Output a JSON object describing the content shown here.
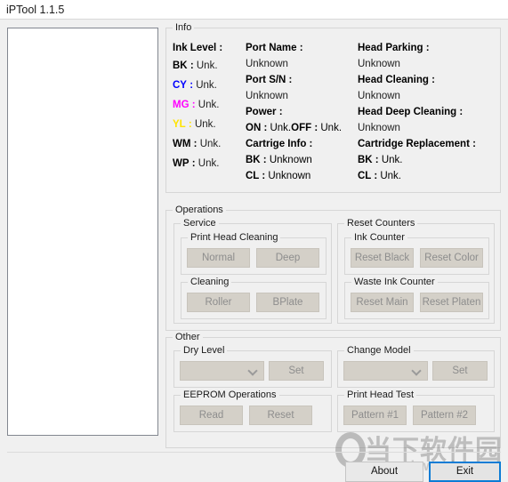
{
  "window": {
    "title": "iPTool 1.1.5"
  },
  "log_panel": {
    "content": ""
  },
  "info": {
    "group_label": "Info",
    "ink_level": {
      "heading": "Ink Level :",
      "rows": [
        {
          "code": "BK",
          "sep": ":",
          "value": "Unk.",
          "color": "#000000"
        },
        {
          "code": "CY",
          "sep": ":",
          "value": "Unk.",
          "color": "#0000ff"
        },
        {
          "code": "MG",
          "sep": ":",
          "value": "Unk.",
          "color": "#ff00ff"
        },
        {
          "code": "YL",
          "sep": ":",
          "value": "Unk.",
          "color": "#ffe400"
        },
        {
          "code": "WM",
          "sep": ":",
          "value": "Unk.",
          "color": "#000000"
        },
        {
          "code": "WP",
          "sep": ":",
          "value": "Unk.",
          "color": "#000000"
        }
      ]
    },
    "middle": {
      "port_name_label": "Port Name :",
      "port_name_value": "Unknown",
      "port_sn_label": "Port S/N :",
      "port_sn_value": "Unknown",
      "power_label": "Power :",
      "power_on_label": "ON :",
      "power_on_value": "Unk.",
      "power_off_label": "OFF :",
      "power_off_value": "Unk.",
      "cartridge_info_label": "Cartrige Info :",
      "cartridge_bk_label": "BK :",
      "cartridge_bk_value": "Unknown",
      "cartridge_cl_label": "CL :",
      "cartridge_cl_value": "Unknown"
    },
    "right": {
      "head_parking_label": "Head Parking :",
      "head_parking_value": "Unknown",
      "head_cleaning_label": "Head Cleaning :",
      "head_cleaning_value": "Unknown",
      "head_deep_cleaning_label": "Head Deep Cleaning :",
      "head_deep_cleaning_value": "Unknown",
      "cartridge_replacement_label": "Cartridge Replacement :",
      "cr_bk_label": "BK :",
      "cr_bk_value": "Unk.",
      "cr_cl_label": "CL :",
      "cr_cl_value": "Unk."
    }
  },
  "operations": {
    "group_label": "Operations",
    "service": {
      "group_label": "Service",
      "print_head_cleaning": {
        "group_label": "Print Head Cleaning",
        "normal_button": "Normal",
        "deep_button": "Deep"
      },
      "cleaning": {
        "group_label": "Cleaning",
        "roller_button": "Roller",
        "bplate_button": "BPlate"
      }
    },
    "reset_counters": {
      "group_label": "Reset Counters",
      "ink_counter": {
        "group_label": "Ink Counter",
        "reset_black_button": "Reset Black",
        "reset_color_button": "Reset Color"
      },
      "waste_ink_counter": {
        "group_label": "Waste Ink Counter",
        "reset_main_button": "Reset Main",
        "reset_platen_button": "Reset Platen"
      }
    }
  },
  "other": {
    "group_label": "Other",
    "dry_level": {
      "group_label": "Dry Level",
      "combo_value": "",
      "set_button": "Set"
    },
    "eeprom_operations": {
      "group_label": "EEPROM Operations",
      "read_button": "Read",
      "reset_button": "Reset"
    },
    "change_model": {
      "group_label": "Change Model",
      "combo_value": "",
      "set_button": "Set"
    },
    "print_head_test": {
      "group_label": "Print Head Test",
      "pattern1_button": "Pattern #1",
      "pattern2_button": "Pattern #2"
    }
  },
  "footer": {
    "about_button": "About",
    "exit_button": "Exit"
  },
  "watermark": {
    "brand": "当下软件园",
    "url": "www.downxia.com"
  }
}
